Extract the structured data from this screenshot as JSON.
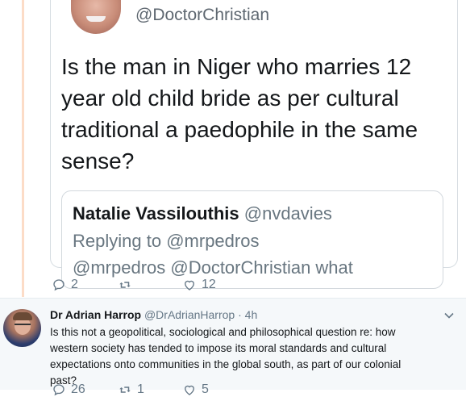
{
  "quoted_tweet": {
    "handle": "@DoctorChristian",
    "text": "Is the man in Niger who marries 12 year old child bride as per cultural traditional a paedophile in the same sense?",
    "quote": {
      "name": "Natalie Vassilouthis",
      "handle": "@nvdavies",
      "replying_prefix": "Replying to",
      "replying_to": "@mrpedros",
      "truncated_line": "@mrpedros @DoctorChristian what"
    }
  },
  "tweet_actions": {
    "replies": "2",
    "retweets": "",
    "likes": "12"
  },
  "reply": {
    "name": "Dr Adrian Harrop",
    "handle": "@DrAdrianHarrop",
    "separator": "·",
    "time": "4h",
    "text": "Is this not a geopolitical, sociological and philosophical question re: how western society has tended to impose its moral standards and cultural expectations onto communities in the global south, as part of our colonial past?",
    "replies": "26",
    "retweets": "1",
    "likes": "5"
  },
  "colors": {
    "thread_line": "#fcdcc7",
    "meta_gray": "#657786",
    "reply_background": "#f5f8fa"
  }
}
